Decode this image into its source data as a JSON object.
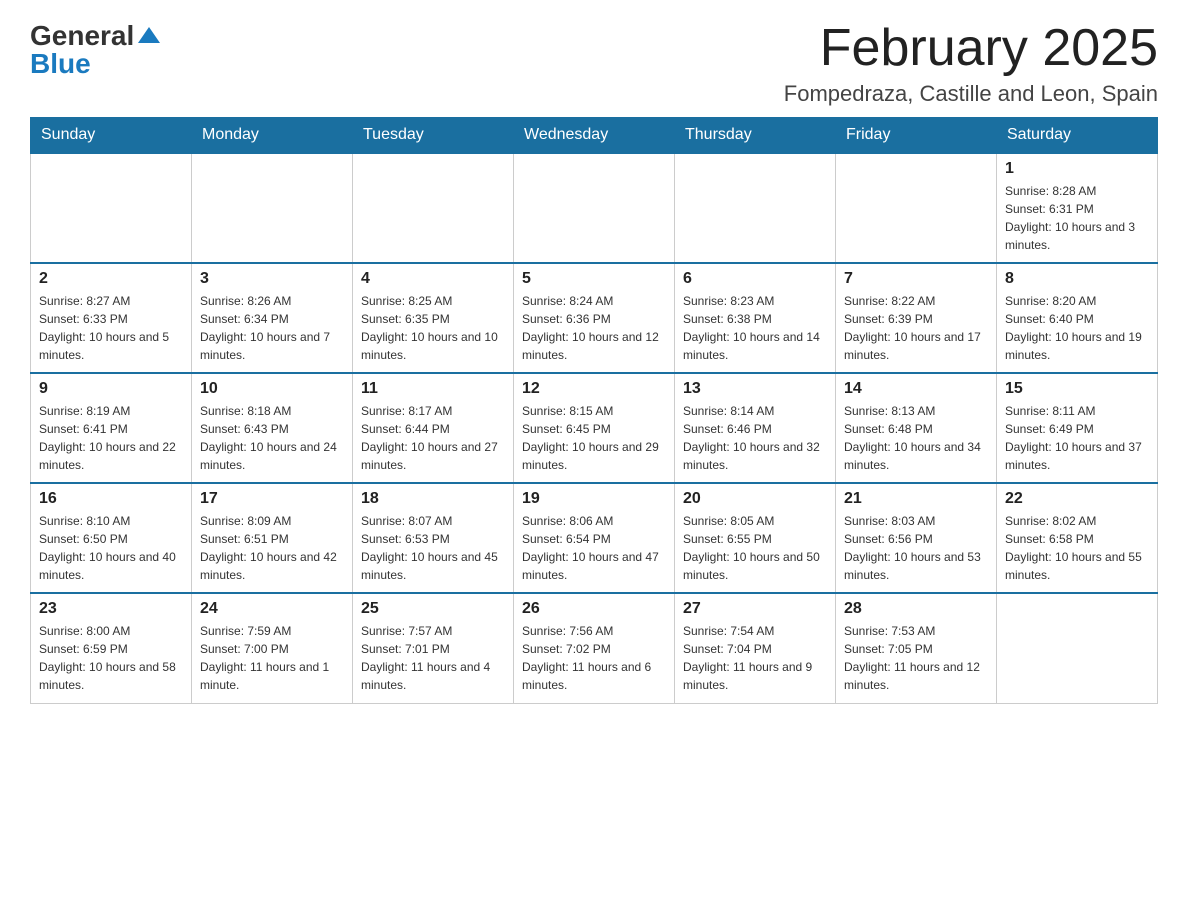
{
  "header": {
    "logo_general": "General",
    "logo_blue": "Blue",
    "month_title": "February 2025",
    "location": "Fompedraza, Castille and Leon, Spain"
  },
  "days_of_week": [
    "Sunday",
    "Monday",
    "Tuesday",
    "Wednesday",
    "Thursday",
    "Friday",
    "Saturday"
  ],
  "weeks": [
    [
      {
        "day": "",
        "info": ""
      },
      {
        "day": "",
        "info": ""
      },
      {
        "day": "",
        "info": ""
      },
      {
        "day": "",
        "info": ""
      },
      {
        "day": "",
        "info": ""
      },
      {
        "day": "",
        "info": ""
      },
      {
        "day": "1",
        "info": "Sunrise: 8:28 AM\nSunset: 6:31 PM\nDaylight: 10 hours and 3 minutes."
      }
    ],
    [
      {
        "day": "2",
        "info": "Sunrise: 8:27 AM\nSunset: 6:33 PM\nDaylight: 10 hours and 5 minutes."
      },
      {
        "day": "3",
        "info": "Sunrise: 8:26 AM\nSunset: 6:34 PM\nDaylight: 10 hours and 7 minutes."
      },
      {
        "day": "4",
        "info": "Sunrise: 8:25 AM\nSunset: 6:35 PM\nDaylight: 10 hours and 10 minutes."
      },
      {
        "day": "5",
        "info": "Sunrise: 8:24 AM\nSunset: 6:36 PM\nDaylight: 10 hours and 12 minutes."
      },
      {
        "day": "6",
        "info": "Sunrise: 8:23 AM\nSunset: 6:38 PM\nDaylight: 10 hours and 14 minutes."
      },
      {
        "day": "7",
        "info": "Sunrise: 8:22 AM\nSunset: 6:39 PM\nDaylight: 10 hours and 17 minutes."
      },
      {
        "day": "8",
        "info": "Sunrise: 8:20 AM\nSunset: 6:40 PM\nDaylight: 10 hours and 19 minutes."
      }
    ],
    [
      {
        "day": "9",
        "info": "Sunrise: 8:19 AM\nSunset: 6:41 PM\nDaylight: 10 hours and 22 minutes."
      },
      {
        "day": "10",
        "info": "Sunrise: 8:18 AM\nSunset: 6:43 PM\nDaylight: 10 hours and 24 minutes."
      },
      {
        "day": "11",
        "info": "Sunrise: 8:17 AM\nSunset: 6:44 PM\nDaylight: 10 hours and 27 minutes."
      },
      {
        "day": "12",
        "info": "Sunrise: 8:15 AM\nSunset: 6:45 PM\nDaylight: 10 hours and 29 minutes."
      },
      {
        "day": "13",
        "info": "Sunrise: 8:14 AM\nSunset: 6:46 PM\nDaylight: 10 hours and 32 minutes."
      },
      {
        "day": "14",
        "info": "Sunrise: 8:13 AM\nSunset: 6:48 PM\nDaylight: 10 hours and 34 minutes."
      },
      {
        "day": "15",
        "info": "Sunrise: 8:11 AM\nSunset: 6:49 PM\nDaylight: 10 hours and 37 minutes."
      }
    ],
    [
      {
        "day": "16",
        "info": "Sunrise: 8:10 AM\nSunset: 6:50 PM\nDaylight: 10 hours and 40 minutes."
      },
      {
        "day": "17",
        "info": "Sunrise: 8:09 AM\nSunset: 6:51 PM\nDaylight: 10 hours and 42 minutes."
      },
      {
        "day": "18",
        "info": "Sunrise: 8:07 AM\nSunset: 6:53 PM\nDaylight: 10 hours and 45 minutes."
      },
      {
        "day": "19",
        "info": "Sunrise: 8:06 AM\nSunset: 6:54 PM\nDaylight: 10 hours and 47 minutes."
      },
      {
        "day": "20",
        "info": "Sunrise: 8:05 AM\nSunset: 6:55 PM\nDaylight: 10 hours and 50 minutes."
      },
      {
        "day": "21",
        "info": "Sunrise: 8:03 AM\nSunset: 6:56 PM\nDaylight: 10 hours and 53 minutes."
      },
      {
        "day": "22",
        "info": "Sunrise: 8:02 AM\nSunset: 6:58 PM\nDaylight: 10 hours and 55 minutes."
      }
    ],
    [
      {
        "day": "23",
        "info": "Sunrise: 8:00 AM\nSunset: 6:59 PM\nDaylight: 10 hours and 58 minutes."
      },
      {
        "day": "24",
        "info": "Sunrise: 7:59 AM\nSunset: 7:00 PM\nDaylight: 11 hours and 1 minute."
      },
      {
        "day": "25",
        "info": "Sunrise: 7:57 AM\nSunset: 7:01 PM\nDaylight: 11 hours and 4 minutes."
      },
      {
        "day": "26",
        "info": "Sunrise: 7:56 AM\nSunset: 7:02 PM\nDaylight: 11 hours and 6 minutes."
      },
      {
        "day": "27",
        "info": "Sunrise: 7:54 AM\nSunset: 7:04 PM\nDaylight: 11 hours and 9 minutes."
      },
      {
        "day": "28",
        "info": "Sunrise: 7:53 AM\nSunset: 7:05 PM\nDaylight: 11 hours and 12 minutes."
      },
      {
        "day": "",
        "info": ""
      }
    ]
  ]
}
